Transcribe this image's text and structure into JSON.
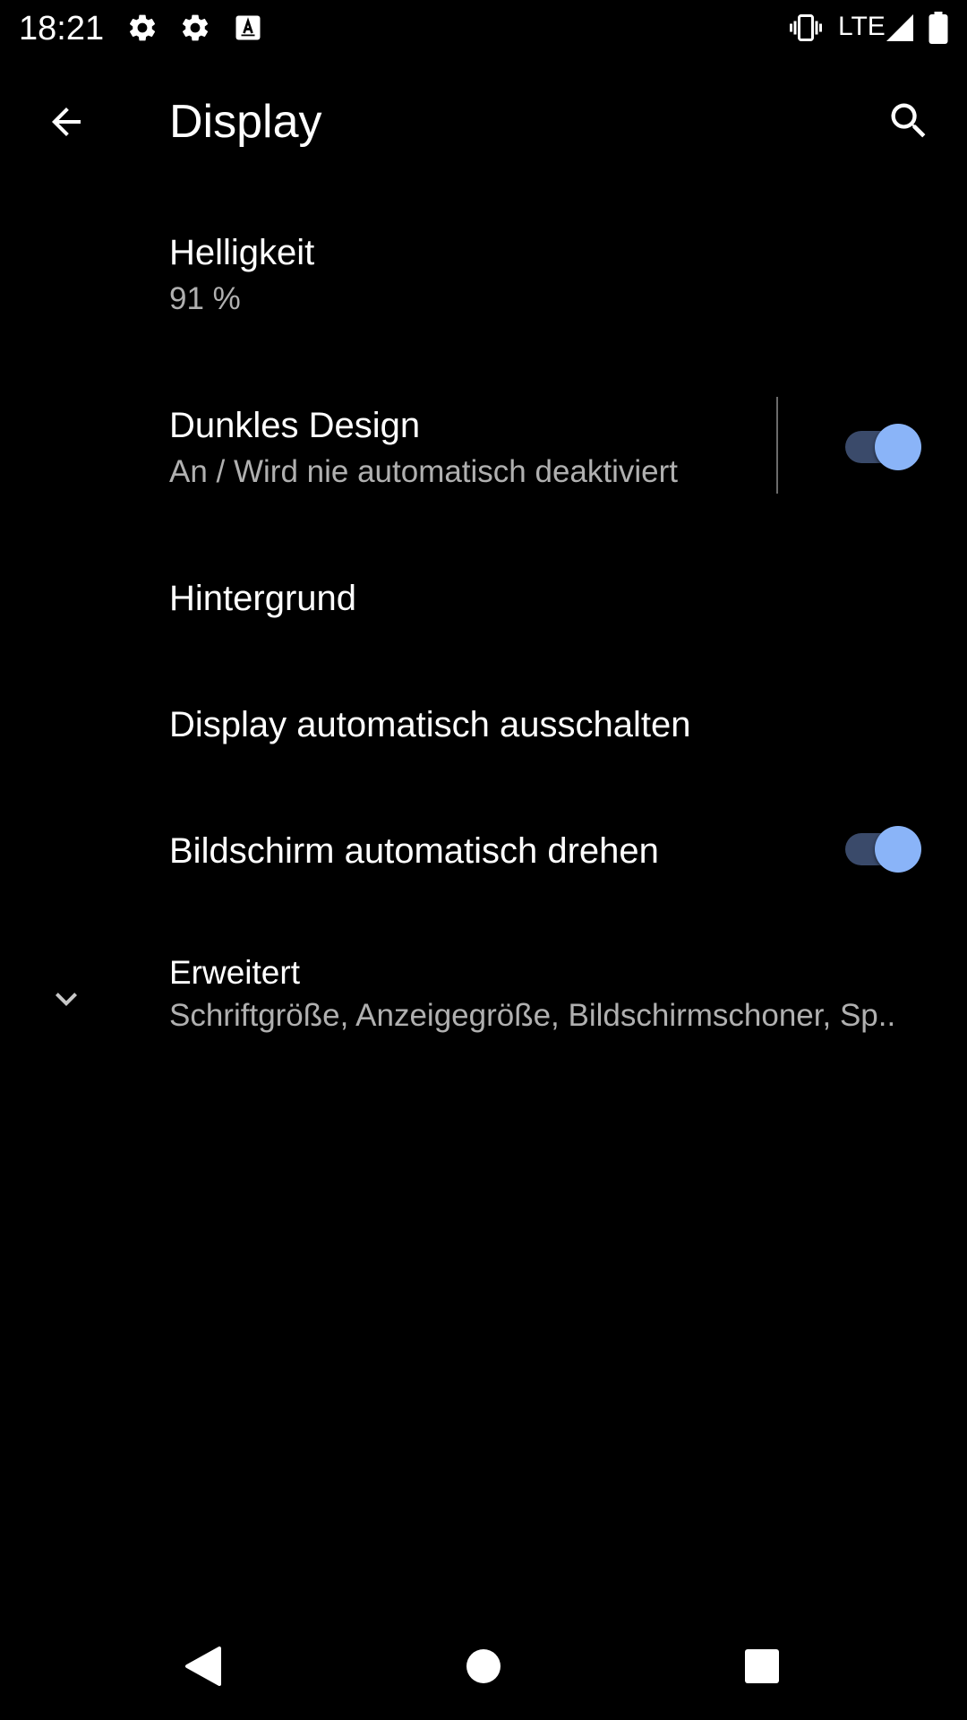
{
  "status_bar": {
    "time": "18:21",
    "network": "LTE",
    "icons": [
      "settings-icon",
      "settings-icon",
      "font-icon",
      "vibrate-icon",
      "signal-icon",
      "battery-icon"
    ]
  },
  "app_bar": {
    "title": "Display",
    "back_icon": "arrow-back-icon",
    "search_icon": "search-icon"
  },
  "settings": [
    {
      "title": "Helligkeit",
      "summary": "91 %"
    },
    {
      "title": "Dunkles Design",
      "summary": "An / Wird nie automatisch deaktiviert",
      "toggle": true
    },
    {
      "title": "Hintergrund"
    },
    {
      "title": "Display automatisch ausschalten"
    },
    {
      "title": "Bildschirm automatisch drehen",
      "toggle": true
    },
    {
      "title": "Erweitert",
      "summary": "Schriftgröße, Anzeigegröße, Bildschirmschoner, Sp..",
      "icon": "chevron-down-icon"
    }
  ],
  "nav_bar": {
    "icons": [
      "nav-back-icon",
      "nav-home-icon",
      "nav-recents-icon"
    ]
  },
  "colors": {
    "background": "#000000",
    "accent": "#8ab4f8",
    "switch_track": "#3a4a6a",
    "summary_text": "#b0b0b0"
  }
}
